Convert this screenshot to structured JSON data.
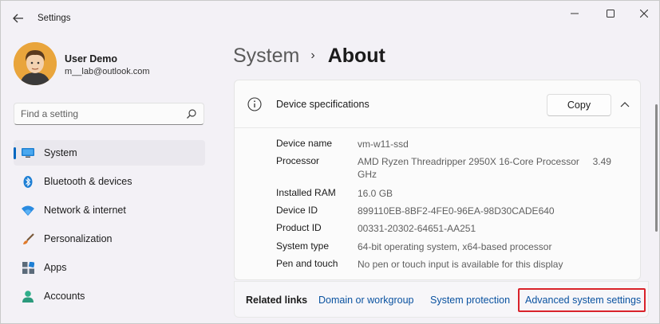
{
  "window": {
    "title": "Settings",
    "back_icon": "back-arrow-icon",
    "controls": [
      "minimize-icon",
      "maximize-icon",
      "close-icon"
    ]
  },
  "profile": {
    "name": "User Demo",
    "email": "m__lab@outlook.com"
  },
  "search": {
    "placeholder": "Find a setting",
    "icon": "search-icon"
  },
  "sidebar": {
    "items": [
      {
        "label": "System",
        "icon": "monitor-icon",
        "active": true
      },
      {
        "label": "Bluetooth & devices",
        "icon": "bluetooth-icon",
        "active": false
      },
      {
        "label": "Network & internet",
        "icon": "wifi-icon",
        "active": false
      },
      {
        "label": "Personalization",
        "icon": "paintbrush-icon",
        "active": false
      },
      {
        "label": "Apps",
        "icon": "apps-icon",
        "active": false
      },
      {
        "label": "Accounts",
        "icon": "person-icon",
        "active": false
      }
    ]
  },
  "breadcrumb": {
    "parent": "System",
    "separator": "›",
    "current": "About"
  },
  "device_specs": {
    "title": "Device specifications",
    "copy_label": "Copy",
    "rows": [
      {
        "label": "Device name",
        "value": "vm-w11-ssd"
      },
      {
        "label": "Processor",
        "value": "AMD Ryzen Threadripper 2950X 16-Core Processor     3.49 GHz"
      },
      {
        "label": "Installed RAM",
        "value": "16.0 GB"
      },
      {
        "label": "Device ID",
        "value": "899110EB-8BF2-4FE0-96EA-98D30CADE640"
      },
      {
        "label": "Product ID",
        "value": "00331-20302-64651-AA251"
      },
      {
        "label": "System type",
        "value": "64-bit operating system, x64-based processor"
      },
      {
        "label": "Pen and touch",
        "value": "No pen or touch input is available for this display"
      }
    ]
  },
  "related_links": {
    "label": "Related links",
    "links": [
      "Domain or workgroup",
      "System protection",
      "Advanced system settings"
    ]
  },
  "colors": {
    "accent": "#0067c0",
    "link": "#0a52a0",
    "highlight": "#d9222a"
  }
}
